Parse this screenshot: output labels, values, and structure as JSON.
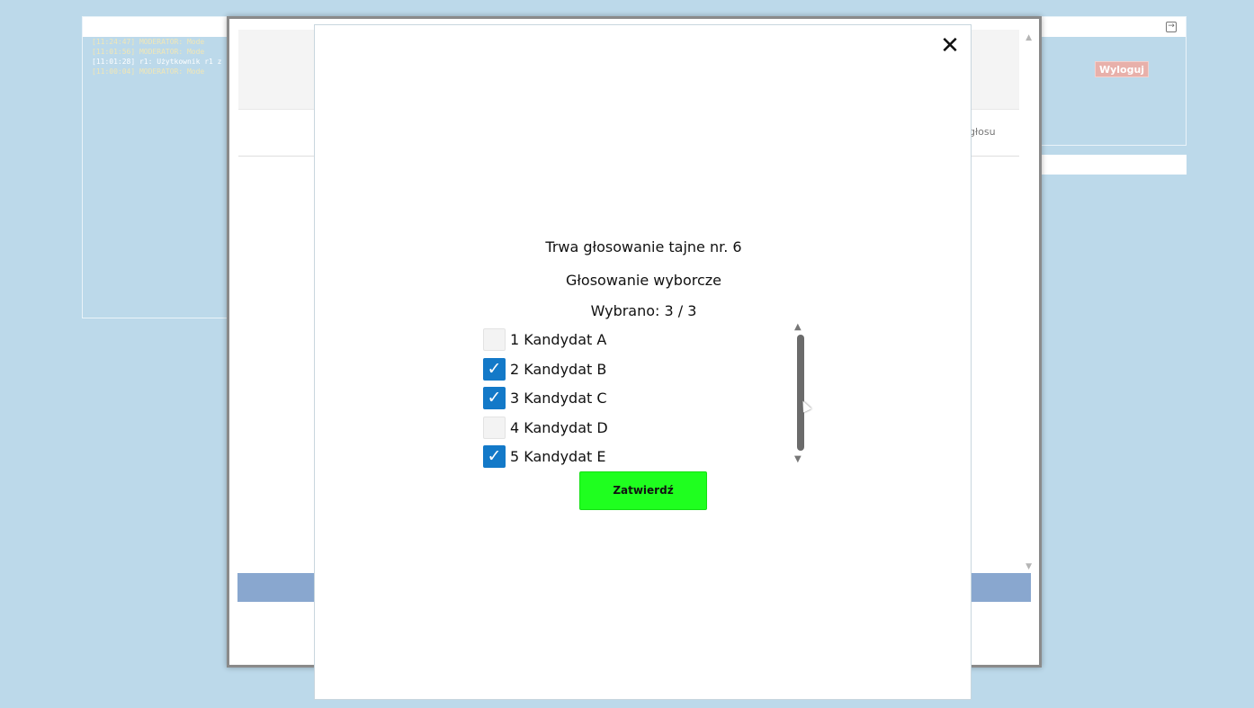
{
  "background": {
    "log_lines": [
      {
        "text": "[11:24:47] MODERATOR: Mode",
        "kind": "moderator"
      },
      {
        "text": "[11:01:56] MODERATOR: Mode",
        "kind": "moderator"
      },
      {
        "text": "[11:01:28] r1: Użytkownik r1 z",
        "kind": "user"
      },
      {
        "text": "[11:00:04] MODERATOR: Mode",
        "kind": "moderator"
      }
    ],
    "logout_label": "Wyloguj",
    "partial_label": "głosu"
  },
  "modal": {
    "title": "Trwa głosowanie tajne nr. 6",
    "subtitle": "Głosowanie wyborcze",
    "counter": "Wybrano: 3 / 3",
    "candidates": [
      {
        "label": "1 Kandydat A",
        "checked": false
      },
      {
        "label": "2 Kandydat B",
        "checked": true
      },
      {
        "label": "3 Kandydat C",
        "checked": true
      },
      {
        "label": "4 Kandydat D",
        "checked": false
      },
      {
        "label": "5 Kandydat E",
        "checked": true
      }
    ],
    "submit_label": "Zatwierdź",
    "close_symbol": "✕"
  },
  "colors": {
    "page_background": "#bcd9ea",
    "checkbox_checked": "#1379c8",
    "submit_button": "#1fff1f",
    "logout_button": "#e8b0aa"
  }
}
